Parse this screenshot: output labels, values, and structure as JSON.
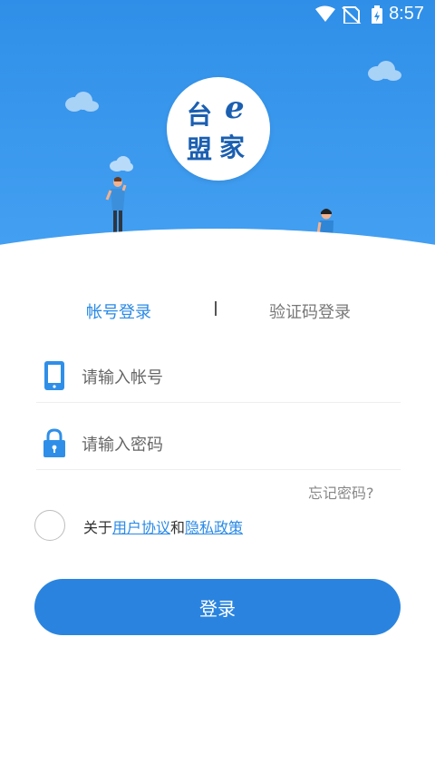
{
  "status_bar": {
    "time": "8:57",
    "icons": [
      "wifi-icon",
      "no-sim-icon",
      "battery-charging-icon"
    ]
  },
  "logo": {
    "char_1": "台",
    "char_2": "e",
    "char_3": "盟",
    "char_4": "家"
  },
  "tabs": [
    {
      "label": "帐号登录",
      "active": true
    },
    {
      "label": "验证码登录",
      "active": false
    }
  ],
  "fields": {
    "account": {
      "placeholder": "请输入帐号",
      "icon": "phone-icon"
    },
    "password": {
      "placeholder": "请输入密码",
      "icon": "lock-icon"
    }
  },
  "forgot_password": "忘记密码?",
  "agreement": {
    "prefix": "关于",
    "user_agreement": "用户协议",
    "conjunction": "和",
    "privacy_policy": "隐私政策"
  },
  "login_button": "登录",
  "colors": {
    "primary": "#2a84df",
    "accent_text": "#2a8ae6",
    "header_top": "#2f8fe8",
    "logo_text": "#1b5fb1"
  }
}
